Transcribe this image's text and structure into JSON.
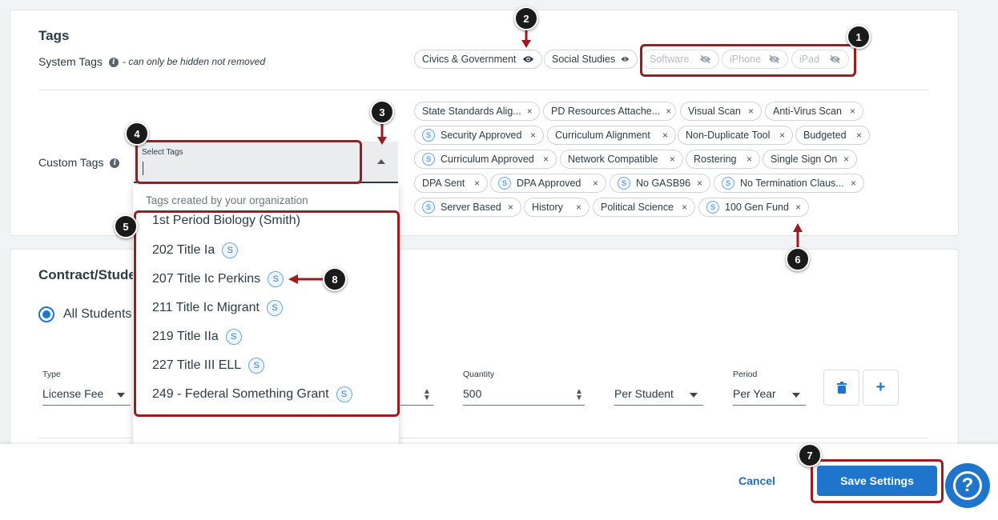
{
  "tags_section": {
    "title": "Tags",
    "system_tags_label": "System Tags",
    "system_tags_hint": "- can only be hidden not removed",
    "system_tags": [
      {
        "label": "Civics & Government",
        "hidden": false
      },
      {
        "label": "Social Studies",
        "hidden": false
      },
      {
        "label": "Software",
        "hidden": true
      },
      {
        "label": "iPhone",
        "hidden": true
      },
      {
        "label": "iPad",
        "hidden": true
      }
    ],
    "custom_tags_label": "Custom Tags",
    "select": {
      "caption": "Select Tags",
      "value": ""
    },
    "dropdown": {
      "group_label": "Tags created by your organization",
      "options": [
        {
          "label": "1st Period Biology (Smith)",
          "badge": ""
        },
        {
          "label": "202 Title Ia",
          "badge": "S"
        },
        {
          "label": "207 Title Ic Perkins",
          "badge": "S"
        },
        {
          "label": "211 Title Ic Migrant",
          "badge": "S"
        },
        {
          "label": "219 Title IIa",
          "badge": "S"
        },
        {
          "label": "227 Title III ELL",
          "badge": "S"
        },
        {
          "label": "249 - Federal Something Grant",
          "badge": "S"
        }
      ]
    },
    "custom_tags": [
      {
        "label": "State Standards Alig...",
        "badge": ""
      },
      {
        "label": "PD Resources Attache...",
        "badge": ""
      },
      {
        "label": "Visual Scan",
        "badge": ""
      },
      {
        "label": "Anti-Virus Scan",
        "badge": ""
      },
      {
        "label": "Security Approved",
        "badge": "S"
      },
      {
        "label": "Curriculum Alignment",
        "badge": ""
      },
      {
        "label": "Non-Duplicate Tool",
        "badge": ""
      },
      {
        "label": "Budgeted",
        "badge": ""
      },
      {
        "label": "Curriculum Approved",
        "badge": "S"
      },
      {
        "label": "Network Compatible",
        "badge": ""
      },
      {
        "label": "Rostering",
        "badge": ""
      },
      {
        "label": "Single Sign On",
        "badge": ""
      },
      {
        "label": "DPA Sent",
        "badge": ""
      },
      {
        "label": "DPA Approved",
        "badge": "S"
      },
      {
        "label": "No GASB96",
        "badge": "S"
      },
      {
        "label": "No Termination Claus...",
        "badge": "S"
      },
      {
        "label": "Server Based",
        "badge": "S"
      },
      {
        "label": "History",
        "badge": ""
      },
      {
        "label": "Political Science",
        "badge": ""
      },
      {
        "label": "100 Gen Fund",
        "badge": "S"
      }
    ]
  },
  "contract_section": {
    "title": "Contract/Stude",
    "radio_label": "All Students",
    "fields": {
      "type": {
        "caption": "Type",
        "value": "License Fee"
      },
      "quantity": {
        "caption": "Quantity",
        "value": "500"
      },
      "unit": {
        "value": "Per Student"
      },
      "period": {
        "caption": "Period",
        "value": "Per Year"
      }
    }
  },
  "footer": {
    "cancel_label": "Cancel",
    "save_label": "Save Settings",
    "help_glyph": "?"
  },
  "callouts": [
    "1",
    "2",
    "3",
    "4",
    "5",
    "6",
    "7",
    "8"
  ],
  "colors": {
    "accent": "#1f75cb",
    "annotation": "#9e1b20"
  }
}
